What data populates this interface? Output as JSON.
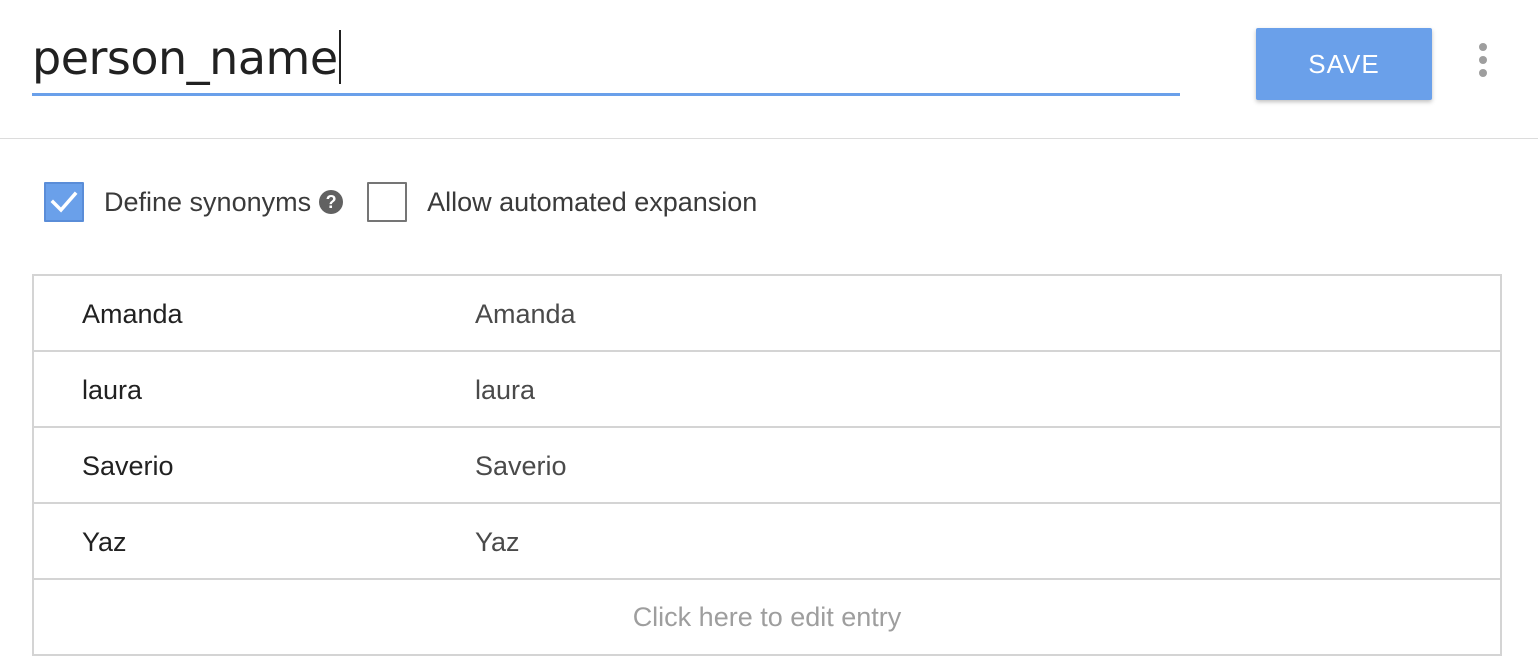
{
  "entity": {
    "name_value": "person_name"
  },
  "toolbar": {
    "save_label": "SAVE",
    "more_icon": "more-vert-icon"
  },
  "options": {
    "define_synonyms": {
      "label": "Define synonyms",
      "checked": true,
      "help_icon": "help-circle-icon"
    },
    "automated_expansion": {
      "label": "Allow automated expansion",
      "checked": false
    }
  },
  "entries": [
    {
      "value": "Amanda",
      "synonyms": "Amanda"
    },
    {
      "value": "laura",
      "synonyms": "laura"
    },
    {
      "value": "Saverio",
      "synonyms": "Saverio"
    },
    {
      "value": "Yaz",
      "synonyms": "Yaz"
    }
  ],
  "edit_entry_label": "Click here to edit entry",
  "colors": {
    "accent": "#6aa0ea",
    "border": "#d4d4d4",
    "muted_text": "#9e9e9e"
  }
}
